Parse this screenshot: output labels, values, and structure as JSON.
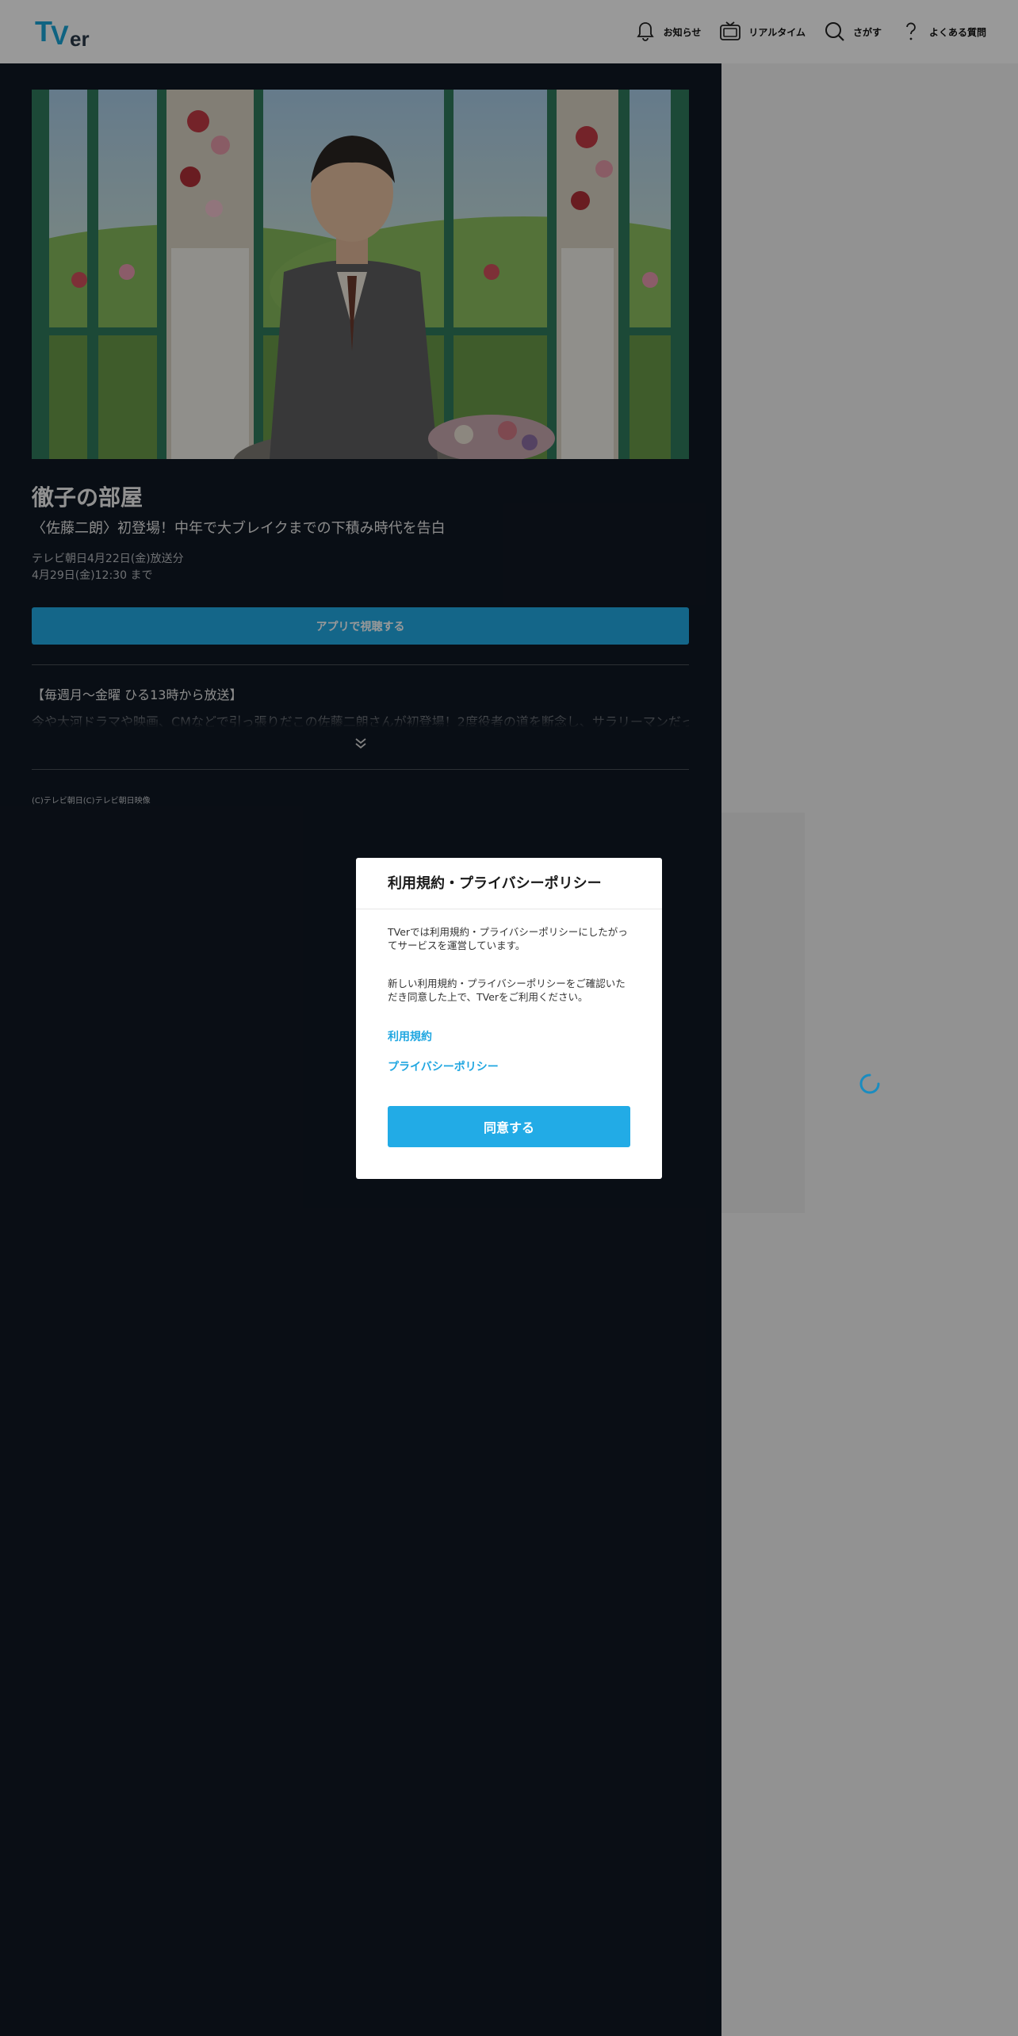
{
  "header": {
    "logo_text": "TVer",
    "nav": [
      {
        "label": "お知らせ",
        "icon": "bell-icon"
      },
      {
        "label": "リアルタイム",
        "icon": "tv-icon"
      },
      {
        "label": "さがす",
        "icon": "search-icon"
      },
      {
        "label": "よくある質問",
        "icon": "question-icon"
      }
    ]
  },
  "episode": {
    "title": "徹子の部屋",
    "subtitle": "〈佐藤二朗〉初登場！中年で大ブレイクまでの下積み時代を告白",
    "broadcast": "テレビ朝日4月22日(金)放送分",
    "available_until": "4月29日(金)12:30 まで",
    "app_button": "アプリで視聴する",
    "description_head": "【毎週月～金曜 ひる13時から放送】",
    "description_preview": "今や大河ドラマや映画、CMなどで引っ張りだこの佐藤二朗さんが初登場！2度役者の道を断念し、サラリーマンだった時代",
    "copyright": "(C)テレビ朝日(C)テレビ朝日映像"
  },
  "modal": {
    "title": "利用規約・プライバシーポリシー",
    "text1": "TVerでは利用規約・プライバシーポリシーにしたがってサービスを運営しています。",
    "text2": "新しい利用規約・プライバシーポリシーをご確認いただき同意した上で、TVerをご利用ください。",
    "link_terms": "利用規約",
    "link_privacy": "プライバシーポリシー",
    "agree_button": "同意する"
  },
  "colors": {
    "accent": "#22abe6",
    "main_bg": "#101823",
    "overlay": "rgba(0,0,0,0.40)"
  }
}
